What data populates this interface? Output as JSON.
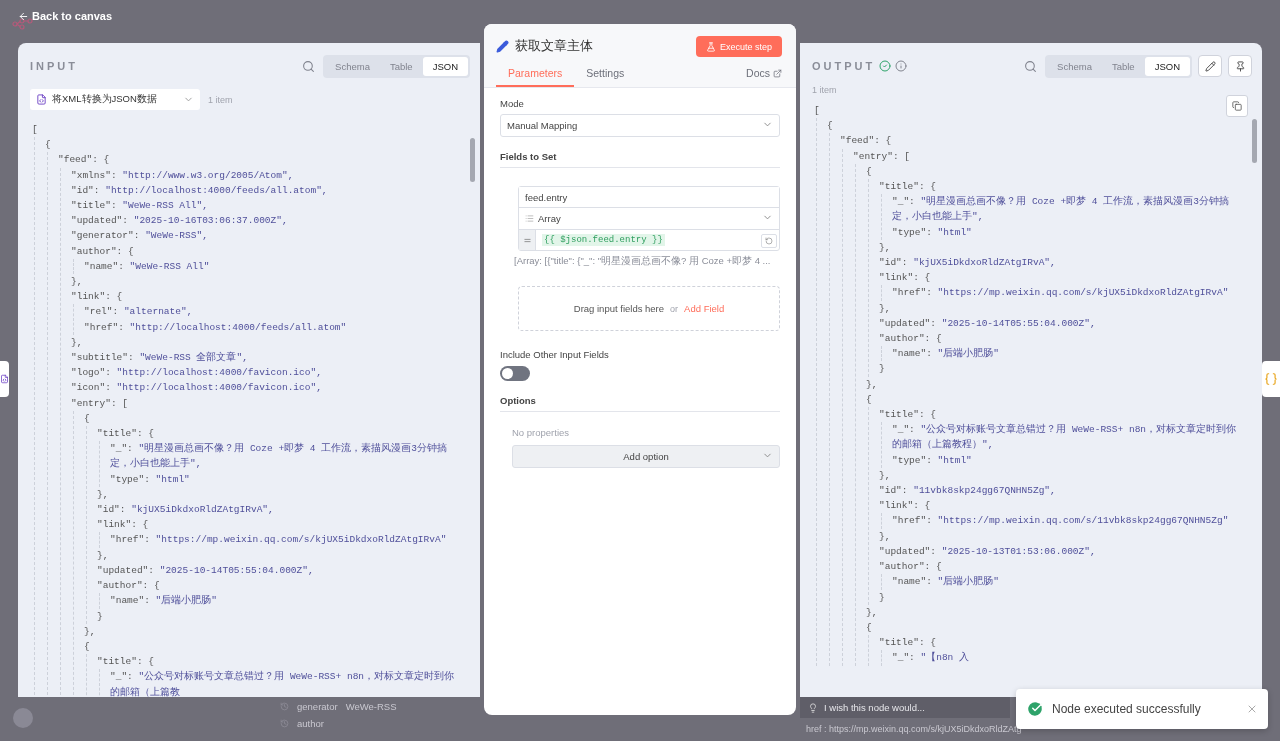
{
  "top_bar": {
    "back_link": "Back to canvas"
  },
  "input_panel": {
    "title": "INPUT",
    "view_tabs": [
      {
        "label": "Schema",
        "selected": false
      },
      {
        "label": "Table",
        "selected": false
      },
      {
        "label": "JSON",
        "selected": true
      }
    ],
    "node_select": {
      "value": "将XML转换为JSON数据"
    },
    "item_count": "1 item",
    "json_lines": [
      {
        "key": "[",
        "children": [
          {
            "key": "{",
            "children": [
              {
                "key": "\"feed\": {",
                "children": [
                  {
                    "key": "\"xmlns\": ",
                    "value": "\"http://www.w3.org/2005/Atom\","
                  },
                  {
                    "key": "\"id\": ",
                    "value": "\"http://localhost:4000/feeds/all.atom\","
                  },
                  {
                    "key": "\"title\": ",
                    "value": "\"WeWe-RSS All\","
                  },
                  {
                    "key": "\"updated\": ",
                    "value": "\"2025-10-16T03:06:37.000Z\","
                  },
                  {
                    "key": "\"generator\": ",
                    "value": "\"WeWe-RSS\","
                  },
                  {
                    "key": "\"author\": {",
                    "children": [
                      {
                        "key": "\"name\": ",
                        "value": "\"WeWe-RSS All\""
                      }
                    ]
                  },
                  {
                    "key": "},"
                  },
                  {
                    "key": "\"link\": {",
                    "children": [
                      {
                        "key": "\"rel\": ",
                        "value": "\"alternate\","
                      },
                      {
                        "key": "\"href\": ",
                        "value": "\"http://localhost:4000/feeds/all.atom\""
                      }
                    ]
                  },
                  {
                    "key": "},"
                  },
                  {
                    "key": "\"subtitle\": ",
                    "value": "\"WeWe-RSS 全部文章\","
                  },
                  {
                    "key": "\"logo\": ",
                    "value": "\"http://localhost:4000/favicon.ico\","
                  },
                  {
                    "key": "\"icon\": ",
                    "value": "\"http://localhost:4000/favicon.ico\","
                  },
                  {
                    "key": "\"entry\": [",
                    "children": [
                      {
                        "key": "{",
                        "children": [
                          {
                            "key": "\"title\": {",
                            "children": [
                              {
                                "key": "\"_\": ",
                                "value": "\"明星漫画总画不像？用 Coze +即梦 4 工作流，素描风漫画3分钟搞定，小白也能上手\","
                              },
                              {
                                "key": "\"type\": ",
                                "value": "\"html\""
                              }
                            ]
                          },
                          {
                            "key": "},"
                          },
                          {
                            "key": "\"id\": ",
                            "value": "\"kjUX5iDkdxoRldZAtgIRvA\","
                          },
                          {
                            "key": "\"link\": {",
                            "children": [
                              {
                                "key": "\"href\": ",
                                "value": "\"https://mp.weixin.qq.com/s/kjUX5iDkdxoRldZAtgIRvA\""
                              }
                            ]
                          },
                          {
                            "key": "},"
                          },
                          {
                            "key": "\"updated\": ",
                            "value": "\"2025-10-14T05:55:04.000Z\","
                          },
                          {
                            "key": "\"author\": {",
                            "children": [
                              {
                                "key": "\"name\": ",
                                "value": "\"后端小肥肠\""
                              }
                            ]
                          },
                          {
                            "key": "}"
                          }
                        ]
                      },
                      {
                        "key": "},"
                      },
                      {
                        "key": "{",
                        "children": [
                          {
                            "key": "\"title\": {",
                            "children": [
                              {
                                "key": "\"_\": ",
                                "value": "\"公众号对标账号文章总错过？用 WeWe-RSS+ n8n，对标文章定时到你的邮箱（上篇教"
                              }
                            ]
                          }
                        ]
                      }
                    ]
                  }
                ]
              }
            ]
          }
        ]
      }
    ]
  },
  "node_panel": {
    "title": "获取文章主体",
    "execute_button": "Execute step",
    "tabs": [
      {
        "label": "Parameters",
        "selected": true
      },
      {
        "label": "Settings",
        "selected": false
      }
    ],
    "docs_link": "Docs",
    "mode": {
      "label": "Mode",
      "value": "Manual Mapping"
    },
    "fields_to_set": {
      "label": "Fields to Set",
      "fields": [
        {
          "name": "feed.entry",
          "type": "Array",
          "value": "{{ $json.feed.entry }}",
          "preview": "[Array: [{\"title\": {\"_\": \"明星漫画总画不像? 用 Coze +即梦 4 ..."
        }
      ],
      "drop_zone": {
        "hint": "Drag input fields here",
        "separator": "or",
        "action": "Add Field"
      }
    },
    "include_other_fields": {
      "label": "Include Other Input Fields",
      "on": false
    },
    "options": {
      "label": "Options",
      "empty": "No properties",
      "add_button": "Add option"
    }
  },
  "output_panel": {
    "title": "OUTPUT",
    "view_tabs": [
      {
        "label": "Schema",
        "selected": false
      },
      {
        "label": "Table",
        "selected": false
      },
      {
        "label": "JSON",
        "selected": true
      }
    ],
    "item_count": "1 item",
    "json_lines": [
      {
        "key": "[",
        "children": [
          {
            "key": "{",
            "children": [
              {
                "key": "\"feed\": {",
                "children": [
                  {
                    "key": "\"entry\": [",
                    "children": [
                      {
                        "key": "{",
                        "children": [
                          {
                            "key": "\"title\": {",
                            "children": [
                              {
                                "key": "\"_\": ",
                                "value": "\"明星漫画总画不像？用 Coze +即梦 4 工作流，素描风漫画3分钟搞定，小白也能上手\","
                              },
                              {
                                "key": "\"type\": ",
                                "value": "\"html\""
                              }
                            ]
                          },
                          {
                            "key": "},"
                          },
                          {
                            "key": "\"id\": ",
                            "value": "\"kjUX5iDkdxoRldZAtgIRvA\","
                          },
                          {
                            "key": "\"link\": {",
                            "children": [
                              {
                                "key": "\"href\": ",
                                "value": "\"https://mp.weixin.qq.com/s/kjUX5iDkdxoRldZAtgIRvA\""
                              }
                            ]
                          },
                          {
                            "key": "},"
                          },
                          {
                            "key": "\"updated\": ",
                            "value": "\"2025-10-14T05:55:04.000Z\","
                          },
                          {
                            "key": "\"author\": {",
                            "children": [
                              {
                                "key": "\"name\": ",
                                "value": "\"后端小肥肠\""
                              }
                            ]
                          },
                          {
                            "key": "}"
                          }
                        ]
                      },
                      {
                        "key": "},"
                      },
                      {
                        "key": "{",
                        "children": [
                          {
                            "key": "\"title\": {",
                            "children": [
                              {
                                "key": "\"_\": ",
                                "value": "\"公众号对标账号文章总错过？用 WeWe-RSS+ n8n，对标文章定时到你的邮箱（上篇教程）\","
                              },
                              {
                                "key": "\"type\": ",
                                "value": "\"html\""
                              }
                            ]
                          },
                          {
                            "key": "},"
                          },
                          {
                            "key": "\"id\": ",
                            "value": "\"11vbk8skp24gg67QNHN5Zg\","
                          },
                          {
                            "key": "\"link\": {",
                            "children": [
                              {
                                "key": "\"href\": ",
                                "value": "\"https://mp.weixin.qq.com/s/11vbk8skp24gg67QNHN5Zg\""
                              }
                            ]
                          },
                          {
                            "key": "},"
                          },
                          {
                            "key": "\"updated\": ",
                            "value": "\"2025-10-13T01:53:06.000Z\","
                          },
                          {
                            "key": "\"author\": {",
                            "children": [
                              {
                                "key": "\"name\": ",
                                "value": "\"后端小肥肠\""
                              }
                            ]
                          },
                          {
                            "key": "}"
                          }
                        ]
                      },
                      {
                        "key": "},"
                      },
                      {
                        "key": "{",
                        "children": [
                          {
                            "key": "\"title\": {",
                            "children": [
                              {
                                "key": "\"_\": ",
                                "value": "\"【n8n 入"
                              }
                            ]
                          }
                        ]
                      }
                    ]
                  }
                ]
              }
            ]
          }
        ]
      }
    ]
  },
  "background": {
    "rows": [
      {
        "key": "generator",
        "value": "WeWe-RSS"
      },
      {
        "key": "author"
      }
    ],
    "href_row": {
      "key": "href :",
      "value": "https://mp.weixin.qq.com/s/kjUX5iDkdxoRldZAtg"
    }
  },
  "feedback_field": {
    "placeholder": "I wish this node would..."
  },
  "toast": {
    "message": "Node executed successfully"
  }
}
